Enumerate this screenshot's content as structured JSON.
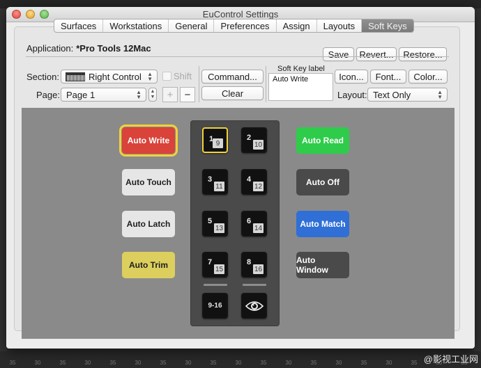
{
  "window": {
    "title": "EuControl Settings"
  },
  "tabs": [
    {
      "label": "Surfaces",
      "active": false
    },
    {
      "label": "Workstations",
      "active": false
    },
    {
      "label": "General",
      "active": false
    },
    {
      "label": "Preferences",
      "active": false
    },
    {
      "label": "Assign",
      "active": false
    },
    {
      "label": "Layouts",
      "active": false
    },
    {
      "label": "Soft Keys",
      "active": true
    }
  ],
  "application": {
    "label": "Application:",
    "value": "*Pro Tools 12Mac"
  },
  "top_buttons": {
    "save": "Save",
    "revert": "Revert...",
    "restore": "Restore..."
  },
  "controls": {
    "section_label": "Section:",
    "section_value": "Right Control",
    "shift_label": "Shift",
    "shift_checked": false,
    "page_label": "Page:",
    "page_value": "Page 1",
    "add_label": "+",
    "remove_label": "−",
    "command_button": "Command...",
    "clear_button": "Clear",
    "soft_key_label_title": "Soft Key label",
    "soft_key_label_value": "Auto Write",
    "icon_button": "Icon...",
    "font_button": "Font...",
    "color_button": "Color...",
    "layout_label": "Layout:",
    "layout_value": "Text Only"
  },
  "soft_keys_left": [
    {
      "label": "Auto Write",
      "bg": "#d9433a",
      "fg": "#ffffff",
      "selected": true
    },
    {
      "label": "Auto Touch",
      "bg": "#e6e6e6",
      "fg": "#1e1e1e",
      "selected": false
    },
    {
      "label": "Auto Latch",
      "bg": "#e6e6e6",
      "fg": "#1e1e1e",
      "selected": false
    },
    {
      "label": "Auto Trim",
      "bg": "#dccf5e",
      "fg": "#1e1e1e",
      "selected": false
    }
  ],
  "soft_keys_right": [
    {
      "label": "Auto Read",
      "bg": "#2ecc4a",
      "fg": "#ffffff"
    },
    {
      "label": "Auto Off",
      "bg": "#4a4a4a",
      "fg": "#ffffff"
    },
    {
      "label": "Auto Match",
      "bg": "#2f6fd6",
      "fg": "#ffffff"
    },
    {
      "label": "Auto Window",
      "bg": "#4a4a4a",
      "fg": "#ffffff"
    }
  ],
  "pads": [
    {
      "main": "1",
      "sub": "9",
      "selected": true
    },
    {
      "main": "2",
      "sub": "10",
      "selected": false
    },
    {
      "main": "3",
      "sub": "11",
      "selected": false
    },
    {
      "main": "4",
      "sub": "12",
      "selected": false
    },
    {
      "main": "5",
      "sub": "13",
      "selected": false
    },
    {
      "main": "6",
      "sub": "14",
      "selected": false
    },
    {
      "main": "7",
      "sub": "15",
      "selected": false
    },
    {
      "main": "8",
      "sub": "16",
      "selected": false
    }
  ],
  "bank_button": "9-16",
  "eye_icon": "eye-icon",
  "background": {
    "meter_ticks": [
      "35",
      "30",
      "35",
      "30",
      "35",
      "30",
      "35",
      "30",
      "35",
      "30",
      "35",
      "30",
      "35",
      "30",
      "35",
      "30",
      "35",
      "30",
      "35"
    ],
    "watermark": "@影视工业网"
  }
}
